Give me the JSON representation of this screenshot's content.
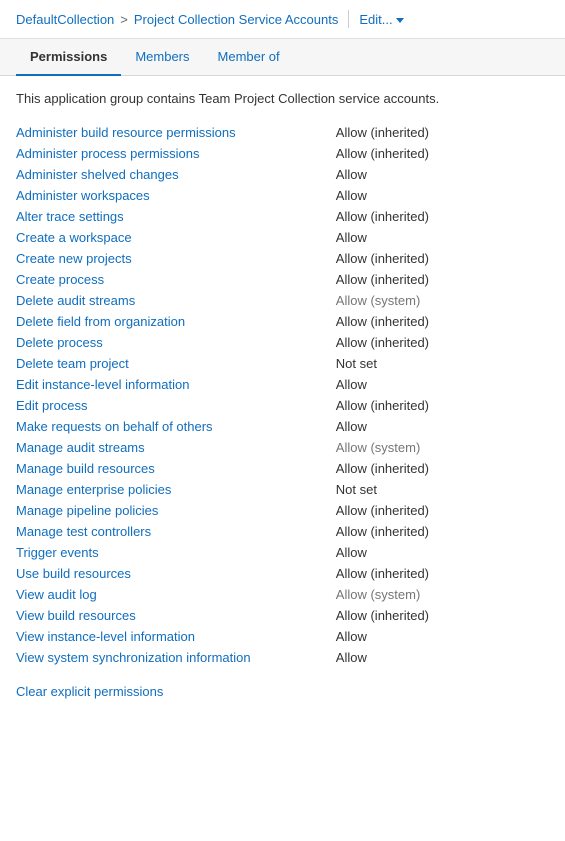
{
  "header": {
    "collection": "DefaultCollection",
    "separator": ">",
    "current": "Project Collection Service Accounts",
    "edit_label": "Edit...",
    "divider": true
  },
  "tabs": [
    {
      "label": "Permissions",
      "active": true
    },
    {
      "label": "Members",
      "active": false
    },
    {
      "label": "Member of",
      "active": false
    }
  ],
  "description": "This application group contains Team Project Collection service accounts.",
  "permissions": [
    {
      "name": "Administer build resource permissions",
      "value": "Allow (inherited)",
      "type": "allow-inherited"
    },
    {
      "name": "Administer process permissions",
      "value": "Allow (inherited)",
      "type": "allow-inherited"
    },
    {
      "name": "Administer shelved changes",
      "value": "Allow",
      "type": "allow"
    },
    {
      "name": "Administer workspaces",
      "value": "Allow",
      "type": "allow"
    },
    {
      "name": "Alter trace settings",
      "value": "Allow (inherited)",
      "type": "allow-inherited"
    },
    {
      "name": "Create a workspace",
      "value": "Allow",
      "type": "allow"
    },
    {
      "name": "Create new projects",
      "value": "Allow (inherited)",
      "type": "allow-inherited"
    },
    {
      "name": "Create process",
      "value": "Allow (inherited)",
      "type": "allow-inherited"
    },
    {
      "name": "Delete audit streams",
      "value": "Allow (system)",
      "type": "allow-system"
    },
    {
      "name": "Delete field from organization",
      "value": "Allow (inherited)",
      "type": "allow-inherited"
    },
    {
      "name": "Delete process",
      "value": "Allow (inherited)",
      "type": "allow-inherited"
    },
    {
      "name": "Delete team project",
      "value": "Not set",
      "type": "not-set"
    },
    {
      "name": "Edit instance-level information",
      "value": "Allow",
      "type": "allow"
    },
    {
      "name": "Edit process",
      "value": "Allow (inherited)",
      "type": "allow-inherited"
    },
    {
      "name": "Make requests on behalf of others",
      "value": "Allow",
      "type": "allow"
    },
    {
      "name": "Manage audit streams",
      "value": "Allow (system)",
      "type": "allow-system"
    },
    {
      "name": "Manage build resources",
      "value": "Allow (inherited)",
      "type": "allow-inherited"
    },
    {
      "name": "Manage enterprise policies",
      "value": "Not set",
      "type": "not-set"
    },
    {
      "name": "Manage pipeline policies",
      "value": "Allow (inherited)",
      "type": "allow-inherited"
    },
    {
      "name": "Manage test controllers",
      "value": "Allow (inherited)",
      "type": "allow-inherited"
    },
    {
      "name": "Trigger events",
      "value": "Allow",
      "type": "allow"
    },
    {
      "name": "Use build resources",
      "value": "Allow (inherited)",
      "type": "allow-inherited"
    },
    {
      "name": "View audit log",
      "value": "Allow (system)",
      "type": "allow-system"
    },
    {
      "name": "View build resources",
      "value": "Allow (inherited)",
      "type": "allow-inherited"
    },
    {
      "name": "View instance-level information",
      "value": "Allow",
      "type": "allow"
    },
    {
      "name": "View system synchronization information",
      "value": "Allow",
      "type": "allow"
    }
  ],
  "clear_label": "Clear explicit permissions"
}
